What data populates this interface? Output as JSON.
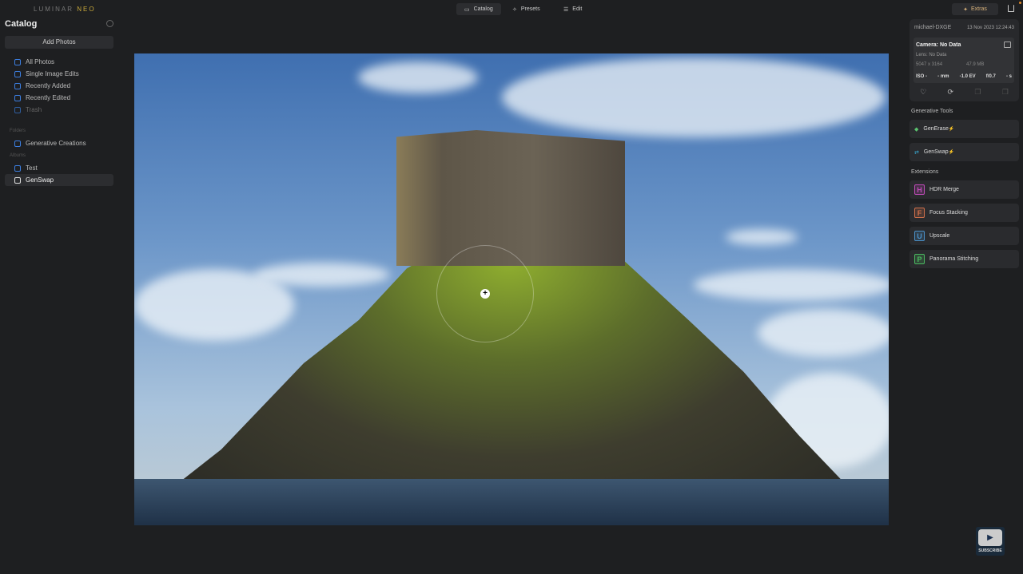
{
  "app": {
    "logo_left": "LUMINAR",
    "logo_right": "NEO"
  },
  "topnav": {
    "catalog": "Catalog",
    "presets": "Presets",
    "edit": "Edit",
    "extras": "Extras"
  },
  "sidebar": {
    "title": "Catalog",
    "add_photos": "Add Photos",
    "items": [
      {
        "label": "All Photos"
      },
      {
        "label": "Single Image Edits"
      },
      {
        "label": "Recently Added"
      },
      {
        "label": "Recently Edited"
      },
      {
        "label": "Trash"
      }
    ],
    "folders_header": "Folders",
    "folders": [
      {
        "label": "Generative Creations"
      }
    ],
    "albums_header": "Albums",
    "albums": [
      {
        "label": "Test"
      },
      {
        "label": "GenSwap"
      }
    ]
  },
  "info": {
    "user": "michael-DXGE",
    "date": "13 Nov 2023 12:24:43",
    "camera": "Camera: No Data",
    "lens": "Lens: No Data",
    "resolution": "5047 x 3164",
    "filesize": "47.9 MB",
    "iso": "ISO -",
    "focal": "- mm",
    "ev": "-1.0 EV",
    "aperture": "f/0.7",
    "shutter": "- s"
  },
  "generative": {
    "header": "Generative Tools",
    "tools": [
      {
        "label": "GenErase"
      },
      {
        "label": "GenSwap"
      }
    ]
  },
  "extensions": {
    "header": "Extensions",
    "items": [
      {
        "letter": "H",
        "label": "HDR Merge",
        "color": "#c04bb8"
      },
      {
        "letter": "F",
        "label": "Focus Stacking",
        "color": "#d0704a"
      },
      {
        "letter": "U",
        "label": "Upscale",
        "color": "#4a90c8"
      },
      {
        "letter": "P",
        "label": "Panorama Stitching",
        "color": "#4ab860"
      }
    ]
  },
  "youtube": {
    "label": "SUBSCRIBE"
  }
}
